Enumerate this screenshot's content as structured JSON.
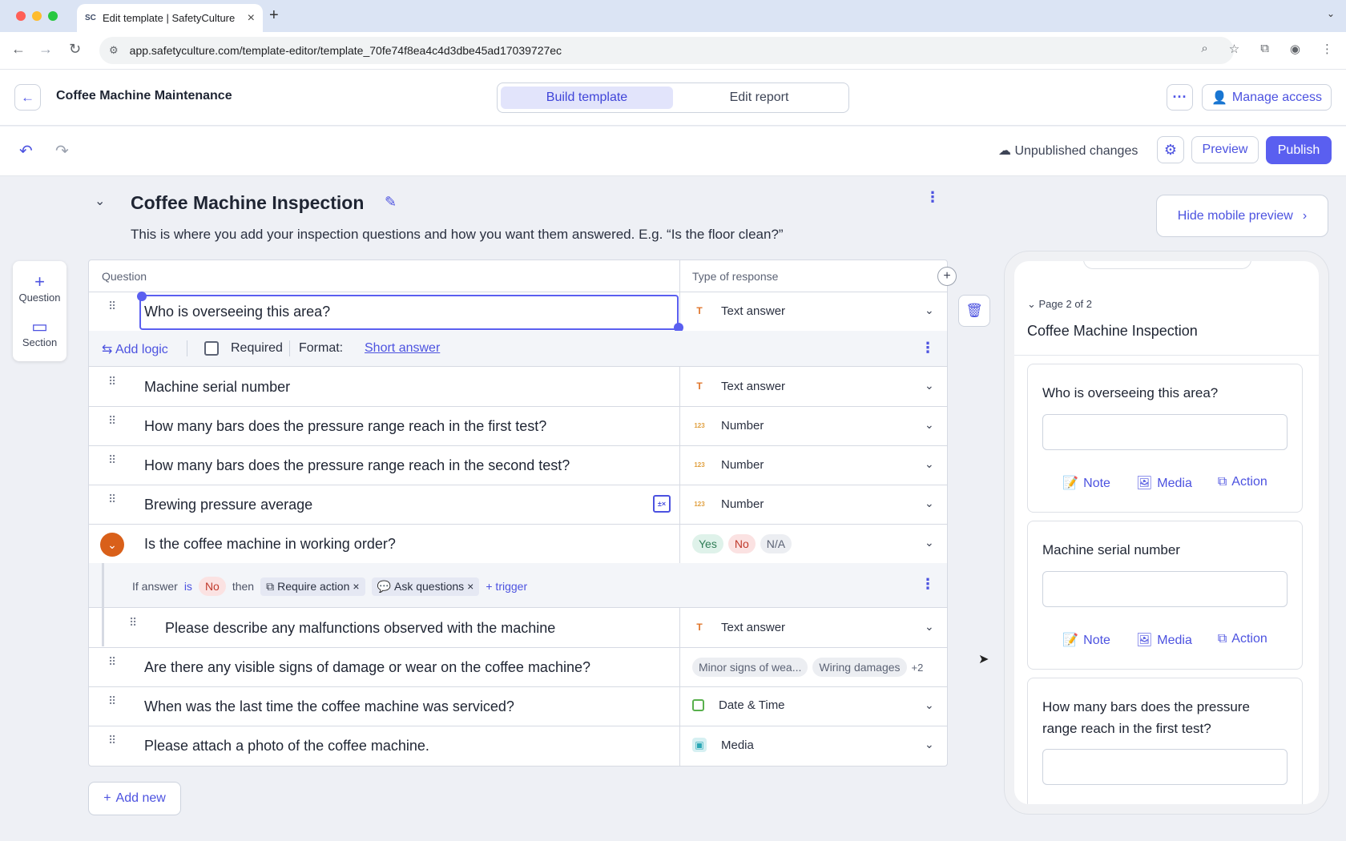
{
  "browser": {
    "tab_title": "Edit template | SafetyCulture",
    "tab_favicon": "SC",
    "url": "app.safetyculture.com/template-editor/template_70fe74f8ea4c4d3dbe45ad17039727ec"
  },
  "header": {
    "title": "Coffee Machine Maintenance",
    "modes": [
      "Build template",
      "Edit report"
    ],
    "active_mode": "Build template",
    "manage_access": "Manage access"
  },
  "toolbar": {
    "status": "Unpublished changes",
    "preview": "Preview",
    "publish": "Publish"
  },
  "rail": {
    "question": "Question",
    "section": "Section"
  },
  "section": {
    "title": "Coffee Machine Inspection",
    "description": "This is where you add your inspection questions and how you want them answered. E.g. “Is the floor clean?”",
    "hide_preview": "Hide mobile preview"
  },
  "table": {
    "col_question": "Question",
    "col_response": "Type of response",
    "rows": [
      {
        "text": "Who is overseeing this area?",
        "type": "Text answer",
        "icon": "text-type-icon"
      },
      {
        "text": "Machine serial number",
        "type": "Text answer",
        "icon": "text-type-icon"
      },
      {
        "text": "How many bars does the pressure range reach in the first test?",
        "type": "Number",
        "icon": "number-type-icon"
      },
      {
        "text": "How many bars does the pressure range reach in the second test?",
        "type": "Number",
        "icon": "number-type-icon"
      },
      {
        "text": "Brewing pressure average",
        "type": "Number",
        "icon": "number-type-icon"
      },
      {
        "text": "Is the coffee machine in working order?",
        "options": [
          "Yes",
          "No",
          "N/A"
        ]
      },
      {
        "text": "Please describe any malfunctions observed with the machine",
        "type": "Text answer",
        "icon": "text-type-icon"
      },
      {
        "text": "Are there any visible signs of damage or wear on the coffee machine?",
        "options": [
          "Minor signs of wea...",
          "Wiring damages",
          "+2"
        ]
      },
      {
        "text": "When was the last time the coffee machine was serviced?",
        "type": "Date & Time",
        "icon": "date-type-icon"
      },
      {
        "text": "Please attach a photo of the coffee machine.",
        "type": "Media",
        "icon": "media-type-icon"
      }
    ],
    "selected_options": {
      "add_logic": "Add logic",
      "required": "Required",
      "format_label": "Format:",
      "format_value": "Short answer"
    },
    "logic": {
      "if_answer": "If answer",
      "is": "is",
      "value": "No",
      "then": "then",
      "trigger1": "Require action",
      "trigger2": "Ask questions",
      "add_trigger": "+ trigger"
    },
    "add_new": "Add new"
  },
  "mobile": {
    "page_label": "Page 2 of 2",
    "title": "Coffee Machine Inspection",
    "cards": [
      {
        "question": "Who is overseeing this area?"
      },
      {
        "question": "Machine serial number"
      },
      {
        "question": "How many bars does the pressure range reach in the first test?"
      }
    ],
    "actions": [
      "Note",
      "Media",
      "Action"
    ]
  },
  "colors": {
    "accent": "#5a5ff0",
    "orange": "#d9601a"
  }
}
